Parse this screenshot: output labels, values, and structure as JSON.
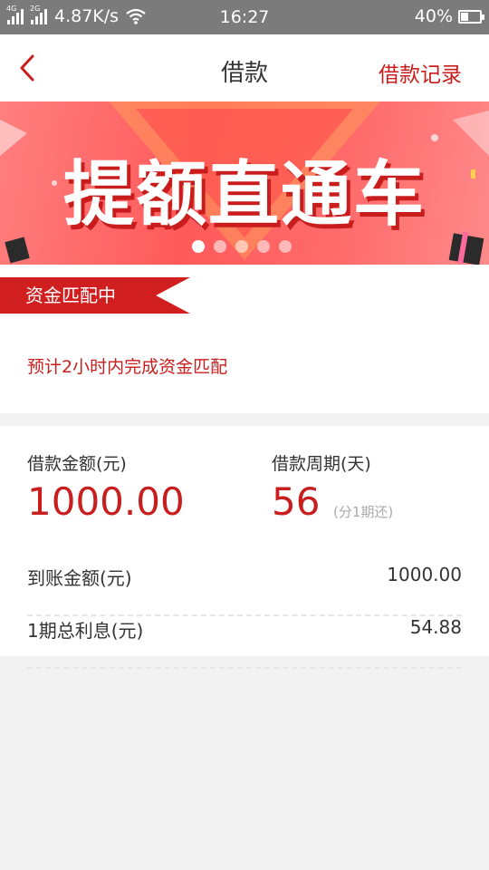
{
  "status_bar": {
    "network_1": "4G",
    "network_2": "2G",
    "speed": "4.87K/s",
    "time": "16:27",
    "battery_text": "40%",
    "battery_level": 0.4
  },
  "nav": {
    "title": "借款",
    "right_link": "借款记录",
    "back_icon": "chevron-left-icon"
  },
  "banner": {
    "text": "提额直通车",
    "slide_count": 5,
    "active_slide": 1
  },
  "status": {
    "badge": "资金匹配中",
    "message": "预计2小时内完成资金匹配"
  },
  "loan": {
    "amount_label": "借款金额(元)",
    "amount_value": "1000.00",
    "period_label": "借款周期(天)",
    "period_value": "56",
    "period_note": "(分1期还)",
    "details": [
      {
        "label": "到账金额(元)",
        "value": "1000.00"
      },
      {
        "label": "1期总利息(元)",
        "value": "54.88"
      }
    ]
  },
  "colors": {
    "accent": "#c81e1e",
    "statusbar": "#7b7b7b",
    "background": "#f2f2f2"
  }
}
